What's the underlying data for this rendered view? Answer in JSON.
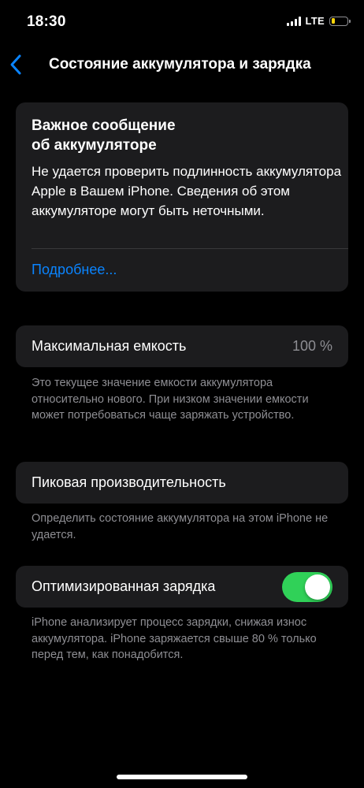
{
  "status_bar": {
    "time": "18:30",
    "network": "LTE",
    "battery_level": 0.2,
    "battery_color": "#ffd60a"
  },
  "nav": {
    "back_icon": "chevron-left-icon",
    "title": "Состояние аккумулятора и зарядка"
  },
  "message": {
    "title_line1": "Важное сообщение",
    "title_line2": "об аккумуляторе",
    "body": "Не удается проверить подлинность аккумулятора Apple в Вашем iPhone. Сведения об этом аккумуляторе могут быть неточными.",
    "link": "Подробнее..."
  },
  "capacity": {
    "label": "Максимальная емкость",
    "value": "100 %",
    "note": "Это текущее значение емкости аккумулятора относительно нового. При низком значении емкости может потребоваться чаще заряжать устройство."
  },
  "peak": {
    "label": "Пиковая производительность",
    "note": "Определить состояние аккумулятора на этом iPhone не удается."
  },
  "charging": {
    "label": "Оптимизированная зарядка",
    "enabled": true,
    "note": "iPhone анализирует процесс зарядки, снижая износ аккумулятора. iPhone заряжается свыше 80 % только перед тем, как понадобится."
  },
  "colors": {
    "accent": "#0a84ff",
    "toggle_on": "#30d158",
    "card_bg": "#1c1c1e"
  }
}
